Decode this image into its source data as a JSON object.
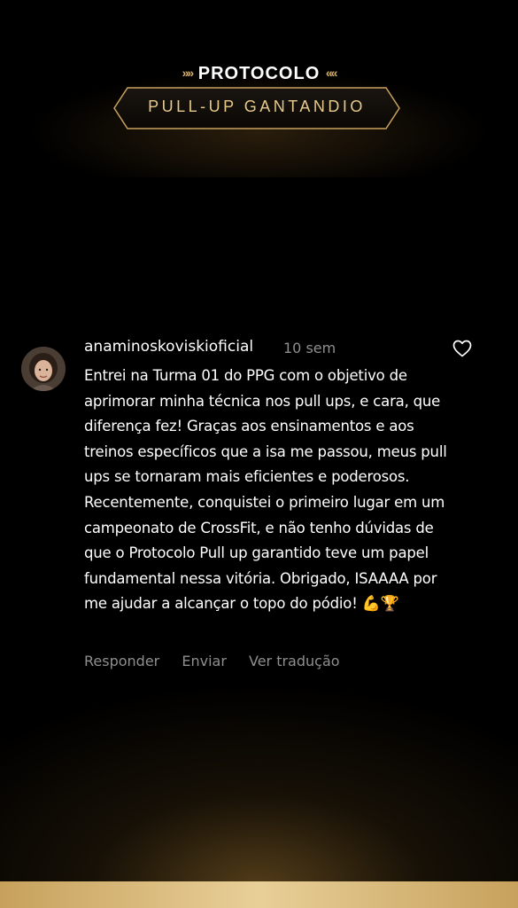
{
  "header": {
    "title_top": "PROTOCOLO",
    "title_bottom": "PULL-UP GANTANDIO",
    "chevrons_left": "»»",
    "chevrons_right": "««",
    "accent_color": "#d7b06a"
  },
  "comment": {
    "username": "anaminoskoviskioficial",
    "time": "10 sem",
    "text": "Entrei na Turma 01 do PPG com o objetivo de aprimorar minha técnica nos pull ups, e cara, que diferença fez! Graças aos ensinamentos e aos treinos específicos que a isa me passou, meus pull ups se tornaram mais eficientes e poderosos. Recentemente, conquistei o primeiro lugar em um campeonato de CrossFit, e não tenho dúvidas de que o Protocolo Pull up garantido teve um papel fundamental nessa vitória. Obrigado, ISAAAA por me ajudar a alcançar o topo do pódio!",
    "emojis": "💪🏆",
    "actions": {
      "reply": "Responder",
      "send": "Enviar",
      "translate": "Ver tradução"
    },
    "icons": {
      "like": "heart-icon"
    }
  }
}
